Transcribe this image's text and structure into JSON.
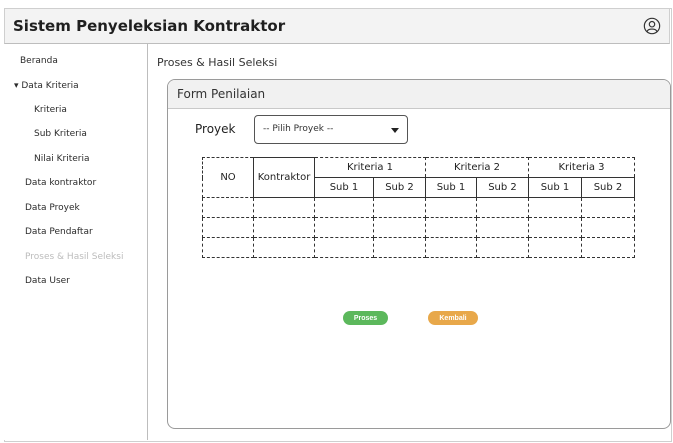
{
  "app": {
    "title": "Sistem Penyeleksian Kontraktor"
  },
  "sidebar": {
    "items": [
      {
        "label": "Beranda",
        "level": 0,
        "active": false
      },
      {
        "label": "▾ Data Kriteria",
        "level": 0,
        "active": false
      },
      {
        "label": "Kriteria",
        "level": 1,
        "active": false
      },
      {
        "label": "Sub Kriteria",
        "level": 1,
        "active": false
      },
      {
        "label": "Nilai Kriteria",
        "level": 1,
        "active": false
      },
      {
        "label": "Data kontraktor",
        "level": 0,
        "active": false
      },
      {
        "label": "Data Proyek",
        "level": 0,
        "active": false
      },
      {
        "label": "Data Pendaftar",
        "level": 0,
        "active": false
      },
      {
        "label": "Proses & Hasil Seleksi",
        "level": 0,
        "active": true
      },
      {
        "label": "Data User",
        "level": 0,
        "active": false
      }
    ]
  },
  "breadcrumb": "Proses & Hasil Seleksi",
  "panel": {
    "title": "Form Penilaian"
  },
  "form": {
    "proyek_label": "Proyek",
    "proyek_value": "-- Pilih Proyek --"
  },
  "table": {
    "headers": {
      "no": "NO",
      "kontraktor": "Kontraktor",
      "kriteria": [
        "Kriteria 1",
        "Kriteria 2",
        "Kriteria 3"
      ],
      "sub": [
        "Sub 1",
        "Sub 2",
        "Sub 1",
        "Sub 2",
        "Sub 1",
        "Sub 2"
      ]
    },
    "rows": [
      [
        "",
        "",
        "",
        "",
        "",
        "",
        "",
        ""
      ],
      [
        "",
        "",
        "",
        "",
        "",
        "",
        "",
        ""
      ],
      [
        "",
        "",
        "",
        "",
        "",
        "",
        "",
        ""
      ]
    ]
  },
  "buttons": {
    "proses": "Proses",
    "kembali": "Kembali"
  },
  "colors": {
    "proses": "#5cb85c",
    "kembali": "#e8a84a"
  }
}
